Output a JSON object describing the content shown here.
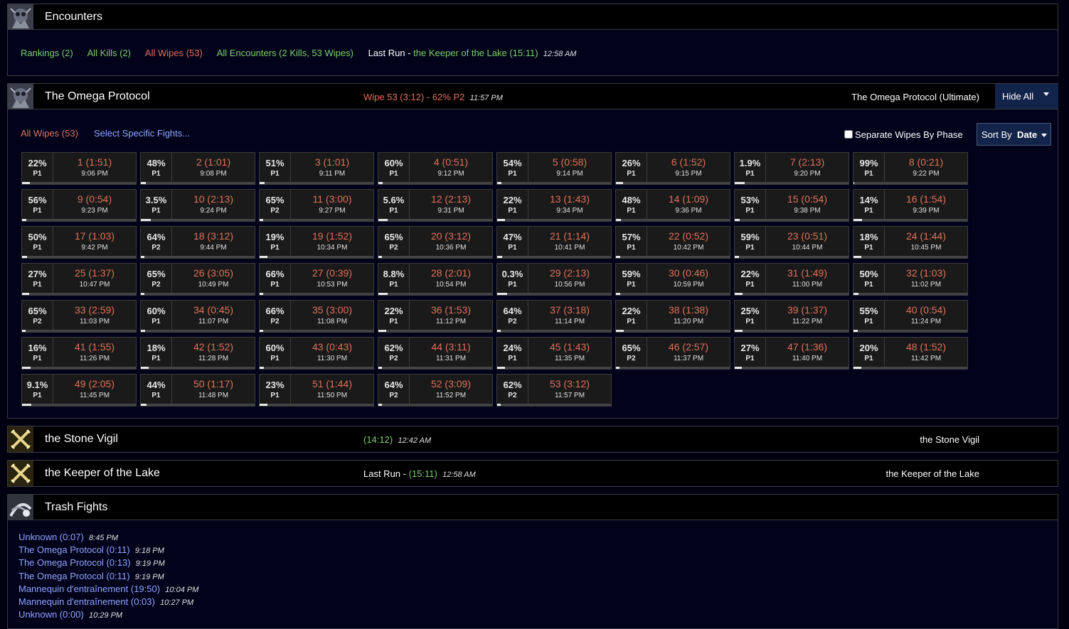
{
  "encounters": {
    "title": "Encounters",
    "links": {
      "rankings": "Rankings (2)",
      "all_kills": "All Kills (2)",
      "all_wipes": "All Wipes (53)",
      "all_encounters": "All Encounters (2 Kills, 53 Wipes)",
      "last_run_label": "Last Run",
      "last_run_sep": " - ",
      "last_run_value": "the Keeper of the Lake (15:11)",
      "last_run_time": "12:58 AM"
    }
  },
  "omega": {
    "title": "The Omega Protocol",
    "latest_wipe": "Wipe 53 (3:12) - 62% P2",
    "latest_wipe_time": "11:57 PM",
    "zone": "The Omega Protocol (Ultimate)",
    "hide_all": "Hide All",
    "all_wipes": "All Wipes (53)",
    "select_specific": "Select Specific Fights...",
    "separate_wipes_label": "Separate Wipes By Phase",
    "separate_wipes_checked": false,
    "sort_by_label": "Sort By",
    "sort_by_value": "Date",
    "wipes": [
      {
        "pct": "22%",
        "phase": "P1",
        "name": "1 (1:51)",
        "time": "9:06 PM",
        "progress": 22
      },
      {
        "pct": "48%",
        "phase": "P1",
        "name": "2 (1:01)",
        "time": "9:08 PM",
        "progress": 48
      },
      {
        "pct": "51%",
        "phase": "P1",
        "name": "3 (1:01)",
        "time": "9:11 PM",
        "progress": 51
      },
      {
        "pct": "60%",
        "phase": "P1",
        "name": "4 (0:51)",
        "time": "9:12 PM",
        "progress": 60
      },
      {
        "pct": "54%",
        "phase": "P1",
        "name": "5 (0:58)",
        "time": "9:14 PM",
        "progress": 54
      },
      {
        "pct": "26%",
        "phase": "P1",
        "name": "6 (1:52)",
        "time": "9:15 PM",
        "progress": 26
      },
      {
        "pct": "1.9%",
        "phase": "P1",
        "name": "7 (2:13)",
        "time": "9:20 PM",
        "progress": 1.9
      },
      {
        "pct": "99%",
        "phase": "P1",
        "name": "8 (0:21)",
        "time": "9:22 PM",
        "progress": 99
      },
      {
        "pct": "56%",
        "phase": "P1",
        "name": "9 (0:54)",
        "time": "9:23 PM",
        "progress": 56
      },
      {
        "pct": "3.5%",
        "phase": "P1",
        "name": "10 (2:13)",
        "time": "9:24 PM",
        "progress": 3.5
      },
      {
        "pct": "65%",
        "phase": "P2",
        "name": "11 (3:00)",
        "time": "9:27 PM",
        "progress": 65
      },
      {
        "pct": "5.6%",
        "phase": "P1",
        "name": "12 (2:13)",
        "time": "9:31 PM",
        "progress": 5.6
      },
      {
        "pct": "22%",
        "phase": "P1",
        "name": "13 (1:43)",
        "time": "9:34 PM",
        "progress": 22
      },
      {
        "pct": "48%",
        "phase": "P1",
        "name": "14 (1:09)",
        "time": "9:36 PM",
        "progress": 48
      },
      {
        "pct": "53%",
        "phase": "P1",
        "name": "15 (0:54)",
        "time": "9:38 PM",
        "progress": 53
      },
      {
        "pct": "14%",
        "phase": "P1",
        "name": "16 (1:54)",
        "time": "9:39 PM",
        "progress": 14
      },
      {
        "pct": "50%",
        "phase": "P1",
        "name": "17 (1:03)",
        "time": "9:42 PM",
        "progress": 50
      },
      {
        "pct": "64%",
        "phase": "P2",
        "name": "18 (3:12)",
        "time": "9:44 PM",
        "progress": 64
      },
      {
        "pct": "19%",
        "phase": "P1",
        "name": "19 (1:52)",
        "time": "10:34 PM",
        "progress": 19
      },
      {
        "pct": "65%",
        "phase": "P2",
        "name": "20 (3:12)",
        "time": "10:36 PM",
        "progress": 65
      },
      {
        "pct": "47%",
        "phase": "P1",
        "name": "21 (1:14)",
        "time": "10:41 PM",
        "progress": 47
      },
      {
        "pct": "57%",
        "phase": "P1",
        "name": "22 (0:52)",
        "time": "10:42 PM",
        "progress": 57
      },
      {
        "pct": "59%",
        "phase": "P1",
        "name": "23 (0:51)",
        "time": "10:44 PM",
        "progress": 59
      },
      {
        "pct": "18%",
        "phase": "P1",
        "name": "24 (1:44)",
        "time": "10:45 PM",
        "progress": 18
      },
      {
        "pct": "27%",
        "phase": "P1",
        "name": "25 (1:37)",
        "time": "10:47 PM",
        "progress": 27
      },
      {
        "pct": "65%",
        "phase": "P2",
        "name": "26 (3:05)",
        "time": "10:49 PM",
        "progress": 65
      },
      {
        "pct": "66%",
        "phase": "P1",
        "name": "27 (0:39)",
        "time": "10:53 PM",
        "progress": 66
      },
      {
        "pct": "8.8%",
        "phase": "P1",
        "name": "28 (2:01)",
        "time": "10:54 PM",
        "progress": 8.8
      },
      {
        "pct": "0.3%",
        "phase": "P1",
        "name": "29 (2:13)",
        "time": "10:56 PM",
        "progress": 0.3
      },
      {
        "pct": "59%",
        "phase": "P1",
        "name": "30 (0:46)",
        "time": "10:59 PM",
        "progress": 59
      },
      {
        "pct": "22%",
        "phase": "P1",
        "name": "31 (1:49)",
        "time": "11:00 PM",
        "progress": 22
      },
      {
        "pct": "50%",
        "phase": "P1",
        "name": "32 (1:03)",
        "time": "11:02 PM",
        "progress": 50
      },
      {
        "pct": "65%",
        "phase": "P2",
        "name": "33 (2:59)",
        "time": "11:03 PM",
        "progress": 65
      },
      {
        "pct": "60%",
        "phase": "P1",
        "name": "34 (0:45)",
        "time": "11:07 PM",
        "progress": 60
      },
      {
        "pct": "66%",
        "phase": "P2",
        "name": "35 (3:00)",
        "time": "11:08 PM",
        "progress": 66
      },
      {
        "pct": "22%",
        "phase": "P1",
        "name": "36 (1:53)",
        "time": "11:12 PM",
        "progress": 22
      },
      {
        "pct": "64%",
        "phase": "P2",
        "name": "37 (3:18)",
        "time": "11:14 PM",
        "progress": 64
      },
      {
        "pct": "22%",
        "phase": "P1",
        "name": "38 (1:38)",
        "time": "11:20 PM",
        "progress": 22
      },
      {
        "pct": "25%",
        "phase": "P1",
        "name": "39 (1:37)",
        "time": "11:22 PM",
        "progress": 25
      },
      {
        "pct": "55%",
        "phase": "P1",
        "name": "40 (0:54)",
        "time": "11:24 PM",
        "progress": 55
      },
      {
        "pct": "16%",
        "phase": "P1",
        "name": "41 (1:55)",
        "time": "11:26 PM",
        "progress": 16
      },
      {
        "pct": "18%",
        "phase": "P1",
        "name": "42 (1:52)",
        "time": "11:28 PM",
        "progress": 18
      },
      {
        "pct": "60%",
        "phase": "P1",
        "name": "43 (0:43)",
        "time": "11:30 PM",
        "progress": 60
      },
      {
        "pct": "62%",
        "phase": "P2",
        "name": "44 (3:11)",
        "time": "11:31 PM",
        "progress": 62
      },
      {
        "pct": "24%",
        "phase": "P1",
        "name": "45 (1:43)",
        "time": "11:35 PM",
        "progress": 24
      },
      {
        "pct": "65%",
        "phase": "P2",
        "name": "46 (2:57)",
        "time": "11:37 PM",
        "progress": 65
      },
      {
        "pct": "27%",
        "phase": "P1",
        "name": "47 (1:36)",
        "time": "11:40 PM",
        "progress": 27
      },
      {
        "pct": "20%",
        "phase": "P1",
        "name": "48 (1:52)",
        "time": "11:42 PM",
        "progress": 20
      },
      {
        "pct": "9.1%",
        "phase": "P1",
        "name": "49 (2:05)",
        "time": "11:45 PM",
        "progress": 9.1
      },
      {
        "pct": "44%",
        "phase": "P1",
        "name": "50 (1:17)",
        "time": "11:48 PM",
        "progress": 44
      },
      {
        "pct": "23%",
        "phase": "P1",
        "name": "51 (1:44)",
        "time": "11:50 PM",
        "progress": 23
      },
      {
        "pct": "64%",
        "phase": "P2",
        "name": "52 (3:09)",
        "time": "11:52 PM",
        "progress": 64
      },
      {
        "pct": "62%",
        "phase": "P2",
        "name": "53 (3:12)",
        "time": "11:57 PM",
        "progress": 62
      }
    ]
  },
  "stone_vigil": {
    "title": "the Stone Vigil",
    "duration": "(14:12)",
    "time": "12:42 AM",
    "zone": "the Stone Vigil"
  },
  "keeper": {
    "title": "the Keeper of the Lake",
    "last_run_label": "Last Run",
    "last_run_sep": " - ",
    "duration": "(15:11)",
    "time": "12:58 AM",
    "zone": "the Keeper of the Lake"
  },
  "trash": {
    "title": "Trash Fights",
    "fights": [
      {
        "name": "Unknown (0:07)",
        "time": "8:45 PM"
      },
      {
        "name": "The Omega Protocol (0:11)",
        "time": "9:18 PM"
      },
      {
        "name": "The Omega Protocol (0:13)",
        "time": "9:19 PM"
      },
      {
        "name": "The Omega Protocol (0:11)",
        "time": "9:19 PM"
      },
      {
        "name": "Mannequin d'entraînement (19:50)",
        "time": "10:04 PM"
      },
      {
        "name": "Mannequin d'entraînement (0:03)",
        "time": "10:27 PM"
      },
      {
        "name": "Unknown (0:00)",
        "time": "10:29 PM"
      }
    ]
  },
  "colors": {
    "kill_green": "#7ad06a",
    "wipe_red": "#e0725a",
    "link_blue": "#8fa6ff",
    "panel_bg": "#02021a",
    "button_bg": "#13244a"
  }
}
